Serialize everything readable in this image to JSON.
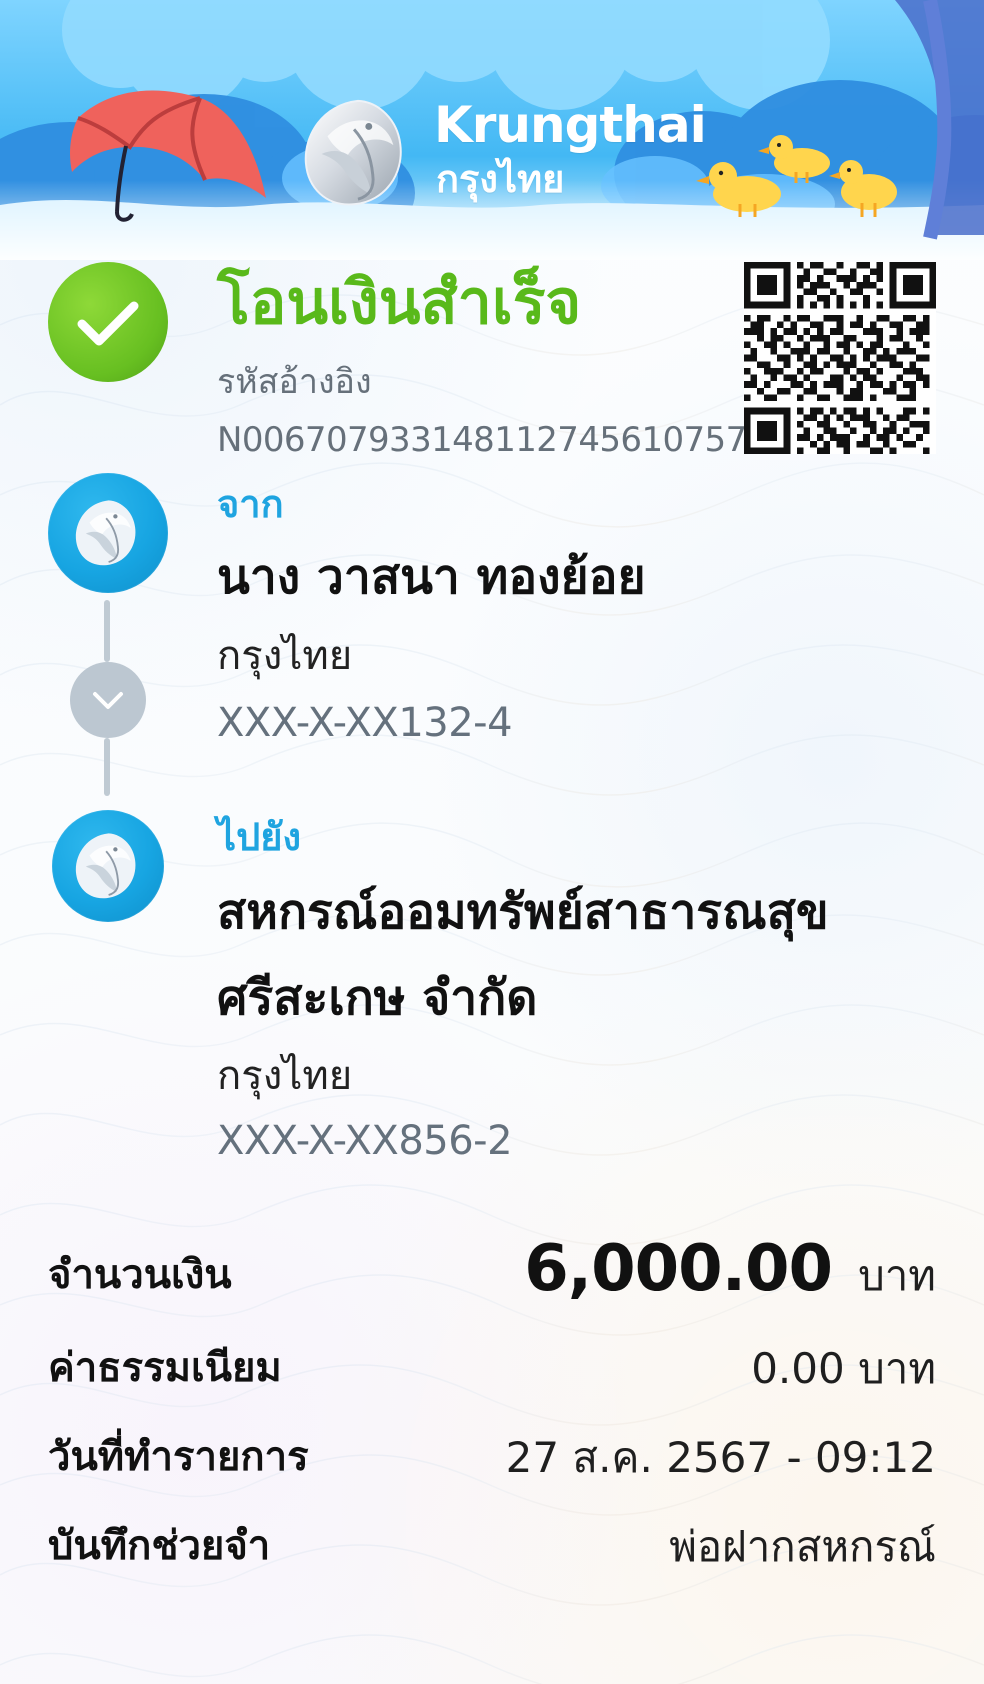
{
  "header": {
    "brand_name": "Krungthai",
    "brand_name_thai": "กรุงไทย"
  },
  "transaction": {
    "status_title": "โอนเงินสำเร็จ",
    "reference_label": "รหัสอ้างอิง",
    "reference_number": "N006707933148112745610757"
  },
  "from": {
    "label": "จาก",
    "name": "นาง วาสนา ทองย้อย",
    "bank": "กรุงไทย",
    "account": "XXX-X-XX132-4"
  },
  "to": {
    "label": "ไปยัง",
    "name_line_1": "สหกรณ์ออมทรัพย์สาธารณสุข",
    "name_line_2": "ศรีสะเกษ จำกัด",
    "bank": "กรุงไทย",
    "account": "XXX-X-XX856-2"
  },
  "details": {
    "amount_label": "จำนวนเงิน",
    "amount_value": "6,000.00",
    "amount_unit": "บาท",
    "fee_label": "ค่าธรรมเนียม",
    "fee_value": "0.00 บาท",
    "date_label": "วันที่ทำรายการ",
    "date_value": "27 ส.ค. 2567 - 09:12",
    "memo_label": "บันทึกช่วยจำ",
    "memo_value": "พ่อฝากสหกรณ์"
  },
  "icons": {
    "success": "check-circle-icon",
    "bank_logo": "krungthai-logo-icon",
    "transfer_arrow": "chevron-down-icon",
    "qr": "qr-code-icon"
  },
  "colors": {
    "success": "#59b91a",
    "accent": "#1fa4e0",
    "muted": "#66707a",
    "timeline": "#bfcad3"
  }
}
